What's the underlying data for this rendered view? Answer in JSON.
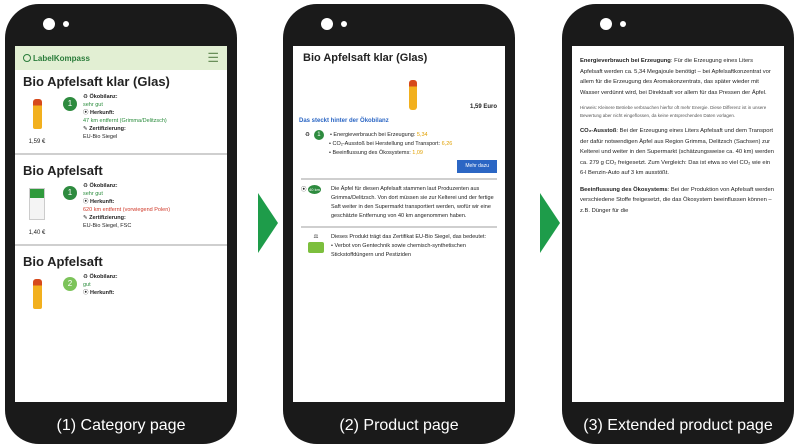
{
  "captions": [
    "(1) Category page",
    "(2) Product page",
    "(3) Extended product page"
  ],
  "p1": {
    "logo": "LabelKompass",
    "products": [
      {
        "title": "Bio Apfelsaft klar (Glas)",
        "price": "1,59 €",
        "score": "1",
        "oekobilanz_label": "Ökobilanz:",
        "oekobilanz": "sehr gut",
        "herkunft_label": "Herkunft:",
        "herkunft": "47 km entfernt (Grimma/Delitzsch)",
        "zert_label": "Zertifizierung:",
        "zert": "EU-Bio Siegel"
      },
      {
        "title": "Bio Apfelsaft",
        "price": "1,40 €",
        "score": "1",
        "oekobilanz_label": "Ökobilanz:",
        "oekobilanz": "sehr gut",
        "herkunft_label": "Herkunft:",
        "herkunft": "620 km entfernt (vorwiegend Polen)",
        "zert_label": "Zertifizierung:",
        "zert": "EU-Bio Siegel, FSC"
      },
      {
        "title": "Bio Apfelsaft",
        "score": "2",
        "oekobilanz_label": "Ökobilanz:",
        "oekobilanz": "gut",
        "herkunft_label": "Herkunft:"
      }
    ]
  },
  "p2": {
    "title": "Bio Apfelsaft klar (Glas)",
    "price": "1,59 Euro",
    "link": "Das steckt hinter der Ökobilanz",
    "score": "1",
    "energy_pre": "Energieverbrauch bei Erzeugung: ",
    "energy_val": "5,34",
    "co2_pre": "CO₂-Ausstoß bei Herstellung und Transport: ",
    "co2_val": "6,26",
    "eco_pre": "Beeinflussung des Ökosystems: ",
    "eco_val": "1,09",
    "more": "Mehr dazu",
    "km_badge": "40 km",
    "origin_text": "Die Äpfel für diesen Apfelsaft stammen laut Produzenten aus Grimma/Delitzsch. Von dort müssen sie zur Kelterei und der fertige Saft weiter in den Supermarkt transportiert werden, wofür wir eine geschätzte Entfernung von 40 km angenommen haben.",
    "cert_text": "Dieses Produkt trägt das Zertifikat EU-Bio Siegel, das bedeutet:",
    "cert_bullet": "Verbot von Gentechnik sowie chemisch-synthetischen Stickstoffdüngern und Pestiziden"
  },
  "p3": {
    "energy_head": "Energieverbrauch bei Erzeugung",
    "energy_text": ": Für die Erzeugung eines Liters Apfelsaft werden ca. 5,34 Megajoule benötigt – bei Apfelsaftkonzentrat vor allem für die Erzeugung des Aromakonzentrats, das später wieder mit Wasser verdünnt wird, bei Direktsaft vor allem für das Pressen der Äpfel.",
    "note": "Hinweis: Kleinere Betriebe verbrauchen hierfür oft mehr Energie. Diese Differenz ist in unsere Bewertung aber nicht eingeflossen, da keine entsprechenden Daten vorlagen.",
    "co2_head": "CO₂-Ausstoß",
    "co2_text": ": Bei der Erzeugung eines Liters Apfelsaft und dem Transport der dafür notwendigen Äpfel aus Region Grimma, Delitzsch (Sachsen) zur Kelterei und weiter in den Supermarkt (schätzungsweise ca. 40 km) werden ca. 279 g CO₂ freigesetzt. Zum Vergleich: Das ist etwa so viel CO₂ wie ein 6-l Benzin-Auto auf 3 km ausstößt.",
    "eco_head": "Beeinflussung des Ökosystems",
    "eco_text": ": Bei der Produktion von Apfelsaft werden verschiedene Stoffe freigesetzt, die das Ökosystem beeinflussen können – z.B. Dünger für die"
  }
}
